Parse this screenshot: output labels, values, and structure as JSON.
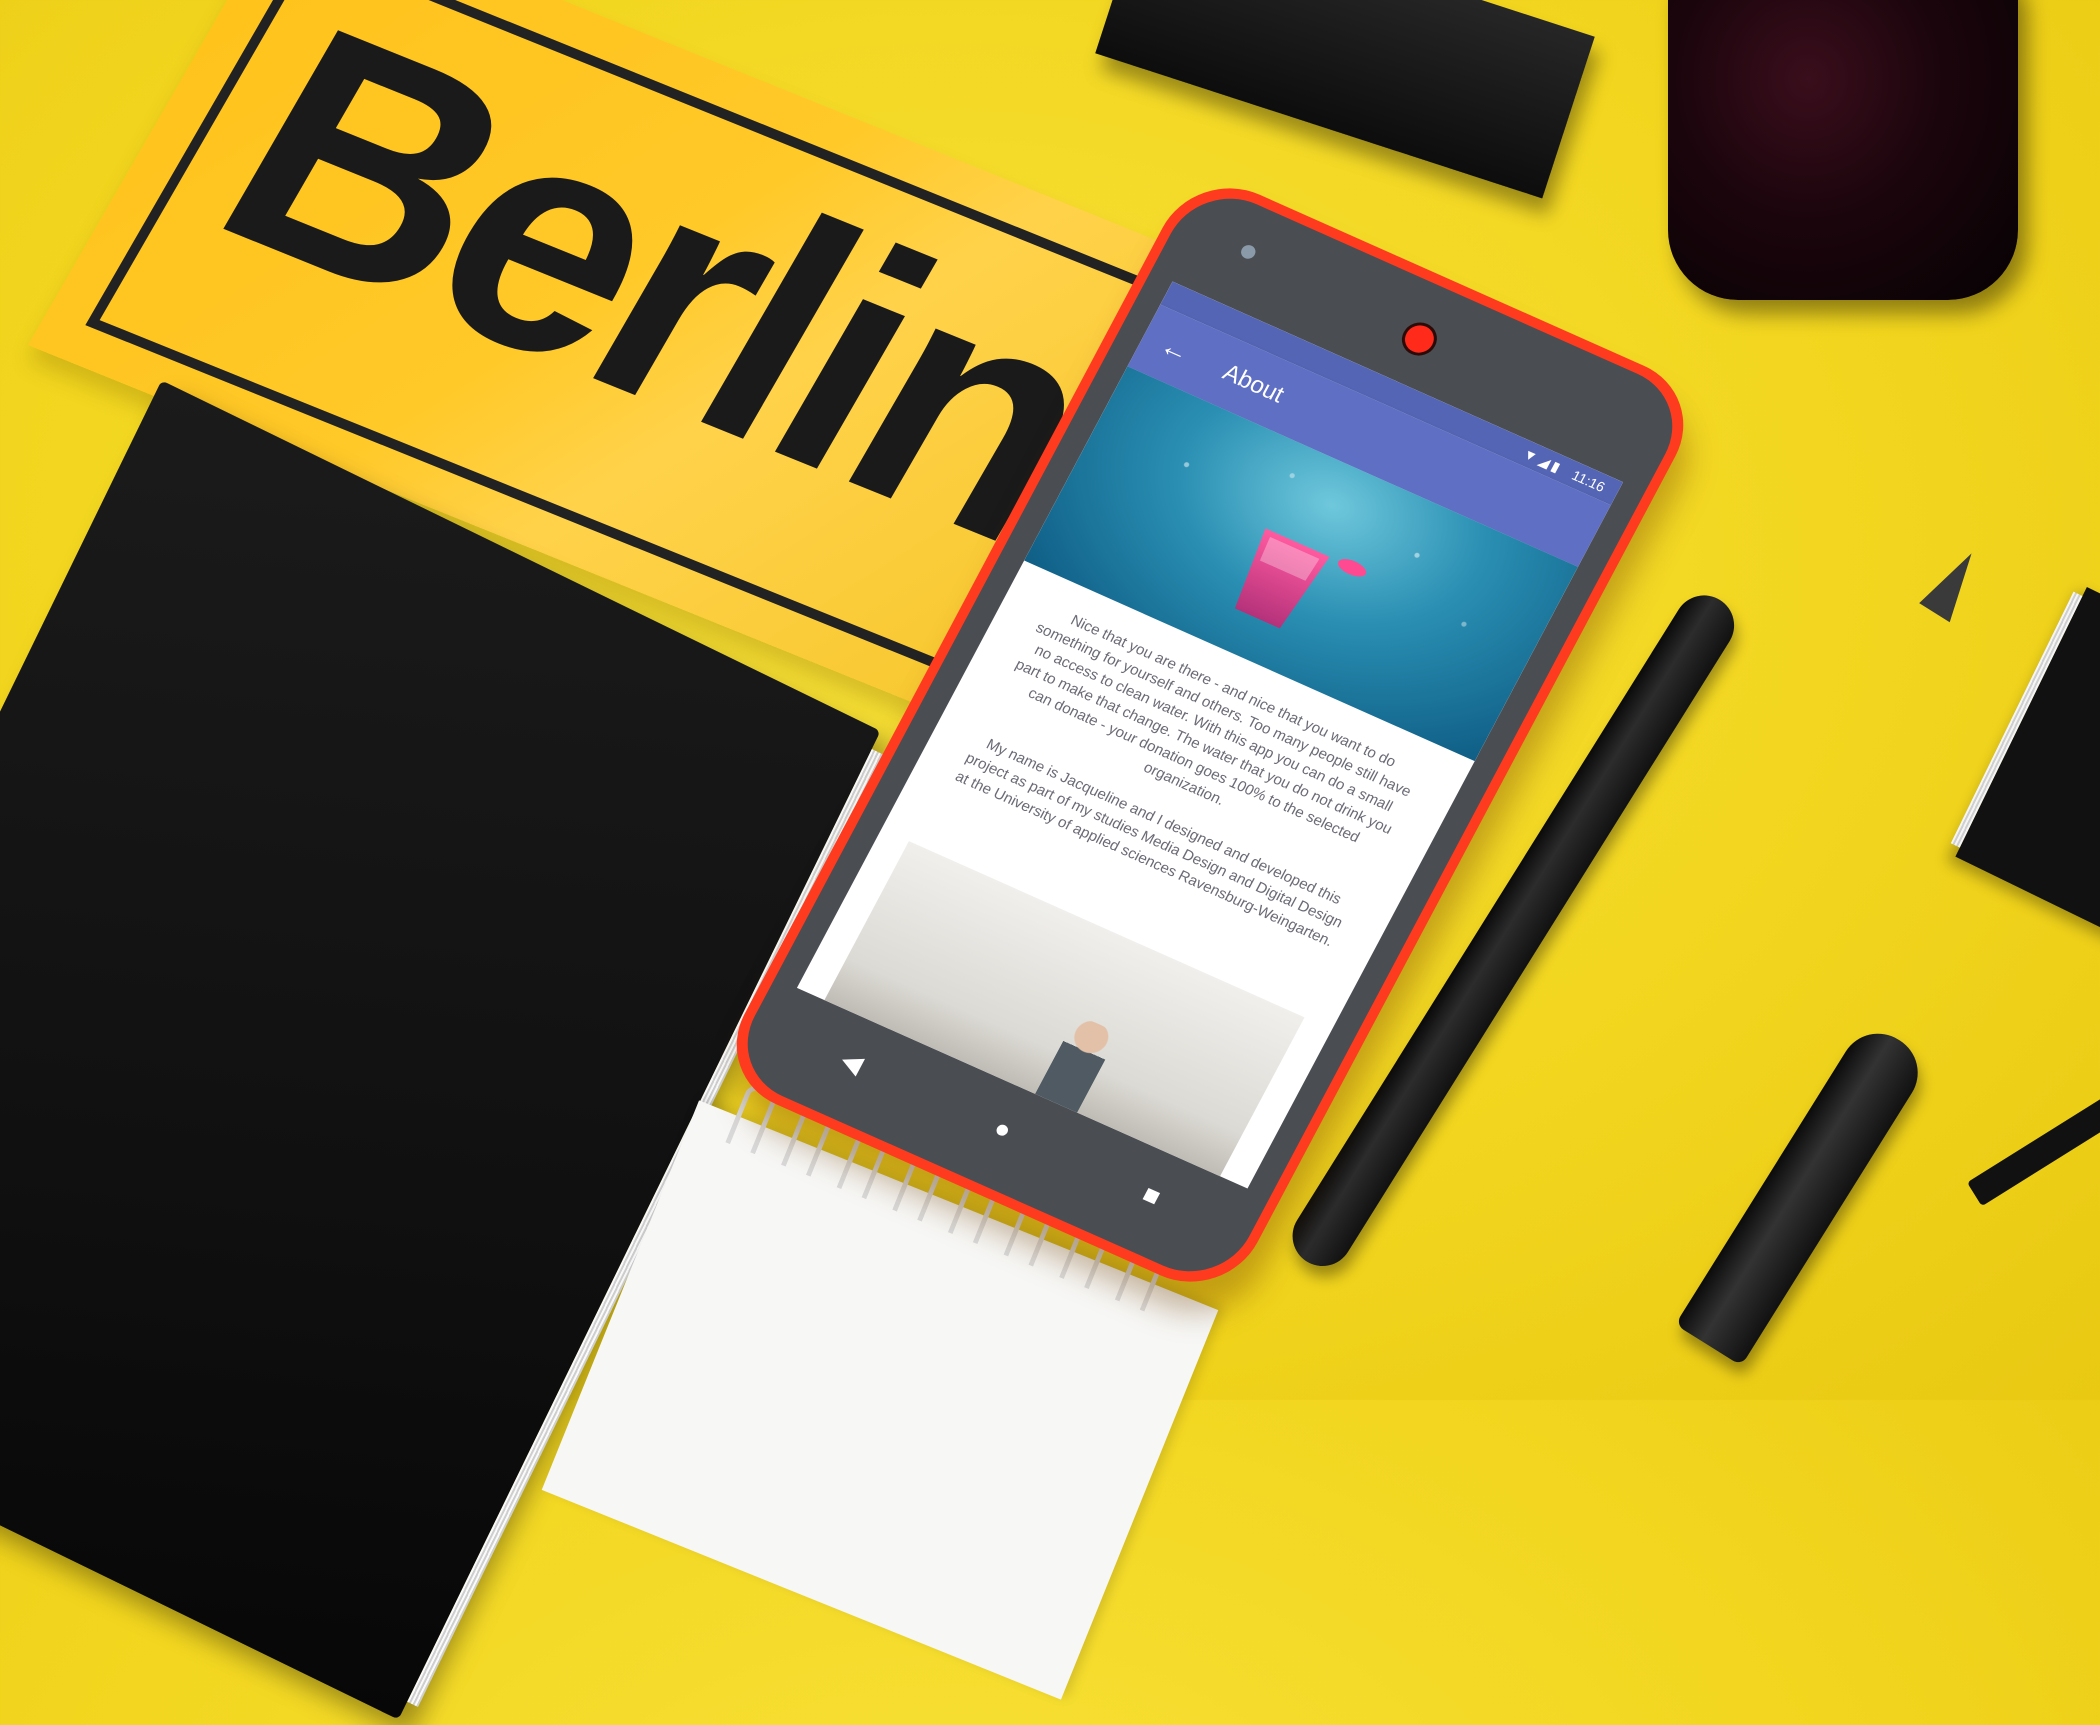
{
  "berlin_sign": {
    "text": "Berlin"
  },
  "phone": {
    "status_bar": {
      "time": "11:16",
      "icons": "▼◢▮"
    },
    "app_bar": {
      "back_icon": "←",
      "title": "About"
    },
    "content": {
      "paragraph_1": "Nice that you are there - and nice that you want to do something for yourself and others. Too many people still have no access to clean water. With this app you can do a small part to make that change. The water that you do not drink you can donate - your donation goes 100% to the selected organization.",
      "paragraph_2": "My name is Jacqueline and I designed and developed this project as part of my studies Media Design and Digital Design at the University of applied sciences Ravensburg-Weingarten."
    },
    "nav": {
      "back": "◀",
      "home": "●",
      "recents": "■"
    }
  },
  "colors": {
    "background": "#f2d61f",
    "phone_body": "#ff3b1f",
    "app_bar": "#5f6fc4",
    "accent_cup": "#ff5aa0"
  }
}
